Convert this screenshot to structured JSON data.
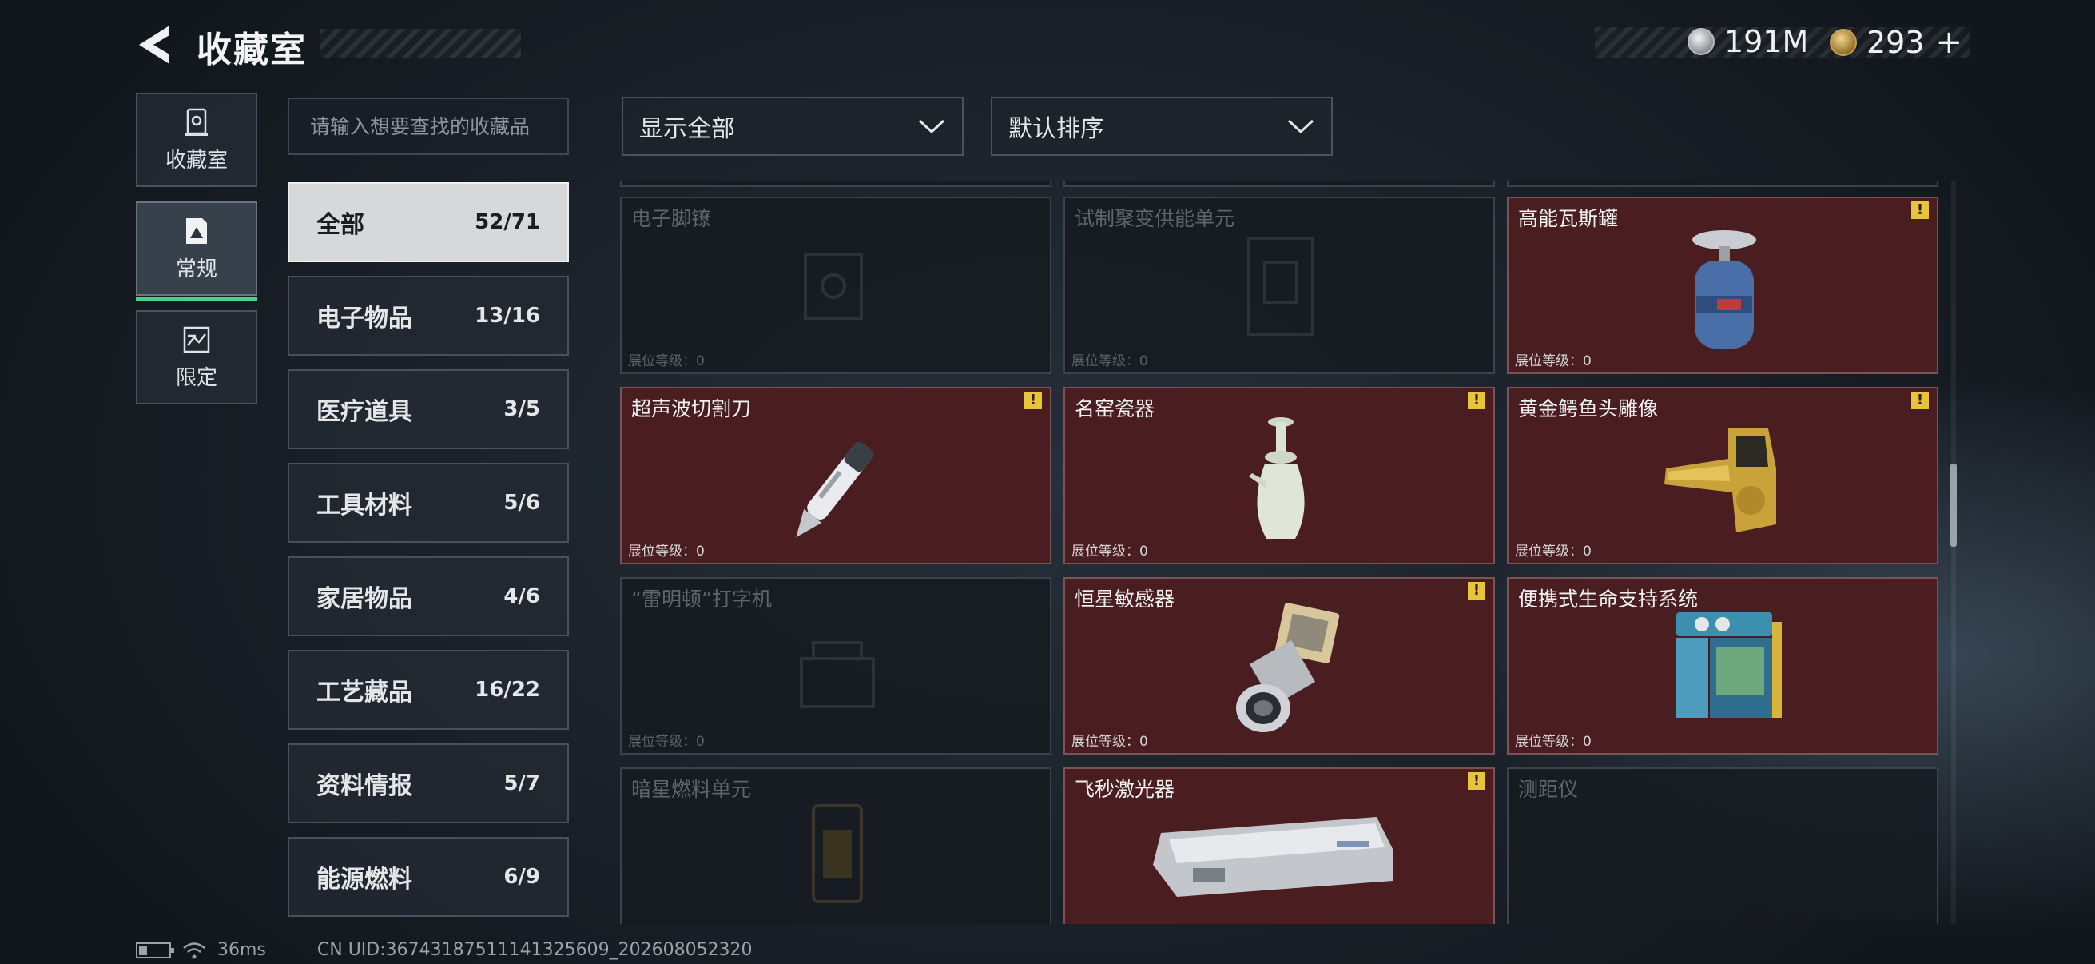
{
  "header": {
    "title": "收藏室",
    "currency": [
      {
        "icon": "silver-coin-icon",
        "value": "191M"
      },
      {
        "icon": "gold-coin-icon",
        "value": "293"
      }
    ],
    "add_symbol": "+"
  },
  "side_tabs": [
    {
      "label": "收藏室",
      "icon": "trophy-case-icon",
      "active": false
    },
    {
      "label": "常规",
      "icon": "document-triangle-icon",
      "active": true
    },
    {
      "label": "限定",
      "icon": "limited-card-icon",
      "active": false
    }
  ],
  "search": {
    "placeholder": "请输入想要查找的收藏品"
  },
  "categories": [
    {
      "label": "全部",
      "count": "52/71",
      "active": true
    },
    {
      "label": "电子物品",
      "count": "13/16"
    },
    {
      "label": "医疗道具",
      "count": "3/5"
    },
    {
      "label": "工具材料",
      "count": "5/6"
    },
    {
      "label": "家居物品",
      "count": "4/6"
    },
    {
      "label": "工艺藏品",
      "count": "16/22"
    },
    {
      "label": "资料情报",
      "count": "5/7"
    },
    {
      "label": "能源燃料",
      "count": "6/9"
    }
  ],
  "filters": {
    "display": "显示全部",
    "sort": "默认排序"
  },
  "items": [
    {
      "name": "电子脚镣",
      "level": "展位等级：0",
      "unlocked": false,
      "warning": false,
      "icon": "ankle-monitor-icon"
    },
    {
      "name": "试制聚变供能单元",
      "level": "展位等级：0",
      "unlocked": false,
      "warning": false,
      "icon": "fusion-cell-icon"
    },
    {
      "name": "高能瓦斯罐",
      "level": "展位等级：0",
      "unlocked": true,
      "warning": true,
      "icon": "gas-canister-icon"
    },
    {
      "name": "超声波切割刀",
      "level": "展位等级：0",
      "unlocked": true,
      "warning": true,
      "icon": "ultrasonic-cutter-icon"
    },
    {
      "name": "名窑瓷器",
      "level": "展位等级：0",
      "unlocked": true,
      "warning": true,
      "icon": "porcelain-vase-icon"
    },
    {
      "name": "黄金鳄鱼头雕像",
      "level": "展位等级：0",
      "unlocked": true,
      "warning": true,
      "icon": "golden-crocodile-statue-icon"
    },
    {
      "name": "“雷明顿”打字机",
      "level": "展位等级：0",
      "unlocked": false,
      "warning": false,
      "icon": "typewriter-icon"
    },
    {
      "name": "恒星敏感器",
      "level": "展位等级：0",
      "unlocked": true,
      "warning": true,
      "icon": "star-sensor-icon"
    },
    {
      "name": "便携式生命支持系统",
      "level": "展位等级：0",
      "unlocked": true,
      "warning": false,
      "icon": "life-support-system-icon"
    },
    {
      "name": "暗星燃料单元",
      "level": "",
      "unlocked": false,
      "warning": false,
      "icon": "fuel-cell-icon"
    },
    {
      "name": "飞秒激光器",
      "level": "",
      "unlocked": true,
      "warning": true,
      "icon": "femtosecond-laser-icon"
    },
    {
      "name": "测距仪",
      "level": "",
      "unlocked": false,
      "warning": false,
      "icon": "rangefinder-icon"
    }
  ],
  "warning_symbol": "!",
  "footer": {
    "ping": "36ms",
    "uid": "CN UID:3674318751114132560​9_202608052320"
  },
  "colors": {
    "accent_green": "#4bd08a",
    "unlocked_card": "#4a1e21",
    "warning_yellow": "#e9c33a"
  }
}
